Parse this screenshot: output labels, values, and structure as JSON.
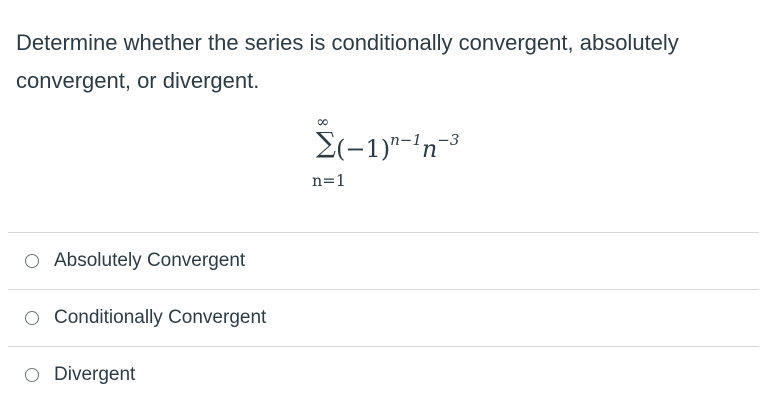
{
  "question": {
    "line1": "Determine whether the series is conditionally convergent, absolutely",
    "line2": "convergent, or divergent."
  },
  "formula": {
    "upper_limit": "∞",
    "sigma": "∑",
    "base": "(−1)",
    "exponent1": "n−1",
    "variable": "n",
    "exponent2": "−3",
    "lower_limit": "n=1"
  },
  "options": [
    {
      "label": "Absolutely Convergent",
      "selected": false
    },
    {
      "label": "Conditionally Convergent",
      "selected": false
    },
    {
      "label": "Divergent",
      "selected": false
    }
  ]
}
